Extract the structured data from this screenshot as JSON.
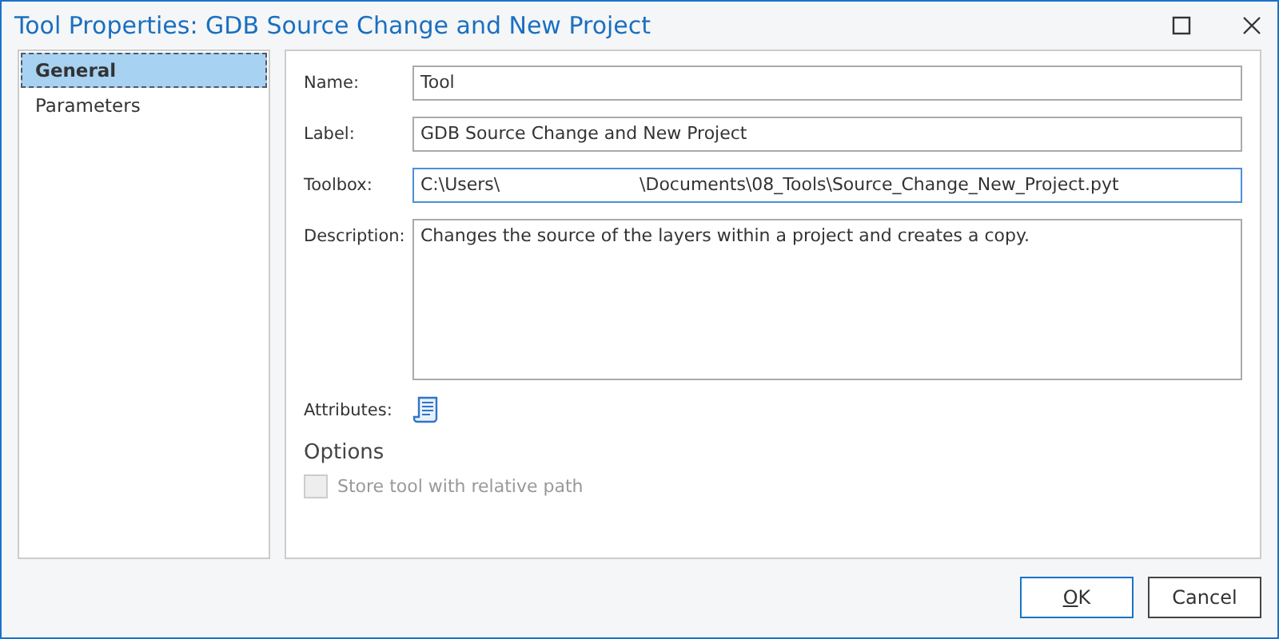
{
  "window": {
    "title": "Tool Properties: GDB Source Change and New Project",
    "controls": [
      {
        "kind": "maximize"
      },
      {
        "kind": "close"
      }
    ]
  },
  "sidebar": {
    "items": [
      {
        "label": "General",
        "selected": true
      },
      {
        "label": "Parameters",
        "selected": false
      }
    ]
  },
  "form": {
    "fields": [
      {
        "label": "Name:",
        "value": "Tool",
        "focused": false,
        "kind": "line"
      },
      {
        "label": "Label:",
        "value": "GDB Source Change and New Project",
        "focused": false,
        "kind": "line"
      },
      {
        "label": "Toolbox:",
        "value": "C:\\Users\\                         \\Documents\\08_Tools\\Source_Change_New_Project.pyt",
        "focused": true,
        "kind": "line"
      },
      {
        "label": "Description:",
        "value": "Changes the source of the layers within a project and creates a copy.",
        "focused": false,
        "kind": "area"
      }
    ],
    "attributes_label": "Attributes:",
    "options": {
      "heading": "Options",
      "checkbox": {
        "label": "Store tool with relative path",
        "checked": false,
        "disabled": true
      }
    }
  },
  "buttons": [
    {
      "label": "OK",
      "default": true
    },
    {
      "label": "Cancel",
      "default": false
    }
  ]
}
